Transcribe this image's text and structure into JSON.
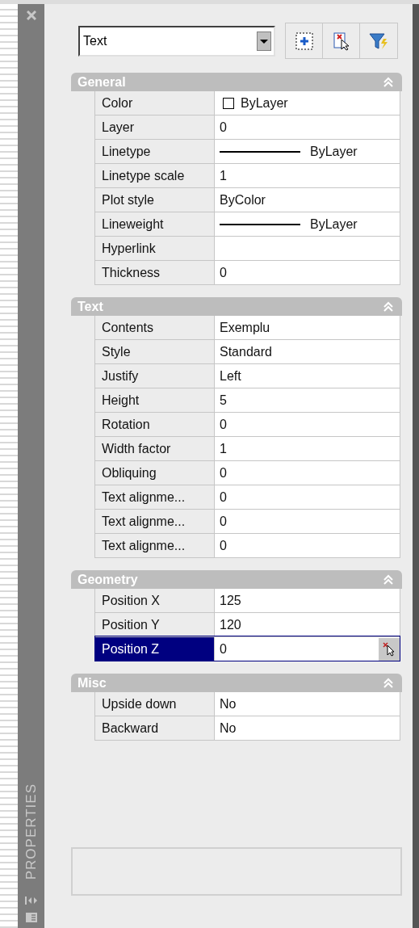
{
  "palette": {
    "title": "PROPERTIES"
  },
  "toolbar": {
    "object_type": "Text"
  },
  "sections": [
    {
      "title": "General",
      "expanded": true,
      "rows": [
        {
          "label": "Color",
          "value": "ByLayer",
          "kind": "color",
          "selected": false
        },
        {
          "label": "Layer",
          "value": "0",
          "kind": "text",
          "selected": false
        },
        {
          "label": "Linetype",
          "value": "ByLayer",
          "kind": "line",
          "selected": false
        },
        {
          "label": "Linetype scale",
          "value": "1",
          "kind": "text",
          "selected": false
        },
        {
          "label": "Plot style",
          "value": "ByColor",
          "kind": "text",
          "selected": false
        },
        {
          "label": "Lineweight",
          "value": "ByLayer",
          "kind": "line",
          "selected": false
        },
        {
          "label": "Hyperlink",
          "value": "",
          "kind": "text",
          "selected": false
        },
        {
          "label": "Thickness",
          "value": "0",
          "kind": "text",
          "selected": false
        }
      ]
    },
    {
      "title": "Text",
      "expanded": true,
      "rows": [
        {
          "label": "Contents",
          "value": "Exemplu",
          "kind": "text",
          "selected": false
        },
        {
          "label": "Style",
          "value": "Standard",
          "kind": "text",
          "selected": false
        },
        {
          "label": "Justify",
          "value": "Left",
          "kind": "text",
          "selected": false
        },
        {
          "label": "Height",
          "value": "5",
          "kind": "text",
          "selected": false
        },
        {
          "label": "Rotation",
          "value": "0",
          "kind": "text",
          "selected": false
        },
        {
          "label": "Width factor",
          "value": "1",
          "kind": "text",
          "selected": false
        },
        {
          "label": "Obliquing",
          "value": "0",
          "kind": "text",
          "selected": false
        },
        {
          "label": "Text alignme...",
          "value": "0",
          "kind": "text",
          "selected": false
        },
        {
          "label": "Text alignme...",
          "value": "0",
          "kind": "text",
          "selected": false
        },
        {
          "label": "Text alignme...",
          "value": "0",
          "kind": "text",
          "selected": false
        }
      ]
    },
    {
      "title": "Geometry",
      "expanded": true,
      "rows": [
        {
          "label": "Position X",
          "value": "125",
          "kind": "text",
          "selected": false
        },
        {
          "label": "Position Y",
          "value": "120",
          "kind": "text",
          "selected": false
        },
        {
          "label": "Position Z",
          "value": "0",
          "kind": "text",
          "selected": true
        }
      ]
    },
    {
      "title": "Misc",
      "expanded": true,
      "rows": [
        {
          "label": "Upside down",
          "value": "No",
          "kind": "text",
          "selected": false
        },
        {
          "label": "Backward",
          "value": "No",
          "kind": "text",
          "selected": false
        }
      ]
    }
  ]
}
